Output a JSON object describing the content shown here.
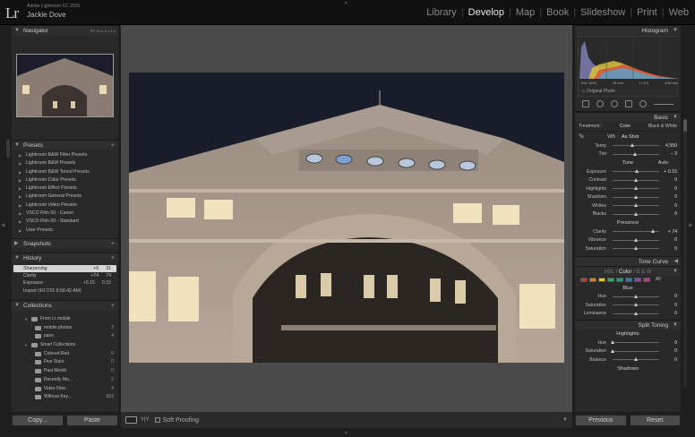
{
  "app": {
    "logo": "Lr",
    "version": "Adobe Lightroom CC 2015",
    "user": "Jackie Dove"
  },
  "modules": [
    "Library",
    "Develop",
    "Map",
    "Book",
    "Slideshow",
    "Print",
    "Web"
  ],
  "active_module": "Develop",
  "left": {
    "navigator": {
      "title": "Navigator",
      "zoom": "FIT  FILL  1:1  1:2"
    },
    "presets": {
      "title": "Presets",
      "items": [
        "Lightroom B&W Filter Presets",
        "Lightroom B&W Presets",
        "Lightroom B&W Toned Presets",
        "Lightroom Color Presets",
        "Lightroom Effect Presets",
        "Lightroom General Presets",
        "Lightroom Video Presets",
        "VSCO Film 00 - Canon",
        "VSCO Film 00 - Standard",
        "User Presets"
      ]
    },
    "snapshots": {
      "title": "Snapshots"
    },
    "history": {
      "title": "History",
      "items": [
        {
          "name": "Sharpening",
          "v1": "+6",
          "v2": "31",
          "selected": true
        },
        {
          "name": "Clarity",
          "v1": "+74",
          "v2": "74",
          "selected": false
        },
        {
          "name": "Exposure",
          "v1": "+0.15",
          "v2": "0.15",
          "selected": false
        },
        {
          "name": "Import (4/17/15 9:56:42 AM)",
          "v1": "",
          "v2": "",
          "selected": false
        }
      ]
    },
    "collections": {
      "title": "Collections",
      "items": [
        {
          "name": "From Lr mobile",
          "count": "",
          "indent": 1,
          "type": "set"
        },
        {
          "name": "mobile photos",
          "count": "2",
          "indent": 2,
          "type": "coll"
        },
        {
          "name": "pano",
          "count": "4",
          "indent": 2,
          "type": "coll"
        },
        {
          "name": "Smart Collections",
          "count": "",
          "indent": 1,
          "type": "set"
        },
        {
          "name": "Colored Red",
          "count": "0",
          "indent": 2,
          "type": "coll"
        },
        {
          "name": "Five Stars",
          "count": "0",
          "indent": 2,
          "type": "coll"
        },
        {
          "name": "Past Month",
          "count": "0",
          "indent": 2,
          "type": "coll"
        },
        {
          "name": "Recently Mo...",
          "count": "2",
          "indent": 2,
          "type": "coll"
        },
        {
          "name": "Video Files",
          "count": "4",
          "indent": 2,
          "type": "coll"
        },
        {
          "name": "Without Key...",
          "count": "603",
          "indent": 2,
          "type": "coll"
        }
      ]
    },
    "buttons": {
      "copy": "Copy...",
      "paste": "Paste"
    }
  },
  "toolbar": {
    "soft_proofing": "Soft Proofing",
    "view_label": "Y|Y"
  },
  "right": {
    "histogram": {
      "title": "Histogram",
      "iso": "ISO 1600",
      "focal": "25 mm",
      "aperture": "f / 4.0",
      "shutter": "1/30 sec",
      "original": "Original Photo"
    },
    "basic": {
      "title": "Basic",
      "treatment_label": "Treatment :",
      "color": "Color",
      "bw": "Black & White",
      "wb_label": "WB :",
      "wb_value": "As Shot",
      "temp": {
        "label": "Temp",
        "value": "4,550",
        "pos": 0.42
      },
      "tint": {
        "label": "Tint",
        "value": "− 3",
        "pos": 0.48
      },
      "tone": "Tone",
      "auto": "Auto",
      "tone_sliders": [
        {
          "label": "Exposure",
          "value": "+ 0.15",
          "pos": 0.52
        },
        {
          "label": "Contrast",
          "value": "0",
          "pos": 0.5
        },
        {
          "label": "Highlights",
          "value": "0",
          "pos": 0.5
        },
        {
          "label": "Shadows",
          "value": "0",
          "pos": 0.5
        },
        {
          "label": "Whites",
          "value": "0",
          "pos": 0.5
        },
        {
          "label": "Blacks",
          "value": "0",
          "pos": 0.5
        }
      ],
      "presence": "Presence",
      "presence_sliders": [
        {
          "label": "Clarity",
          "value": "+ 74",
          "pos": 0.87
        },
        {
          "label": "Vibrance",
          "value": "0",
          "pos": 0.5
        },
        {
          "label": "Saturation",
          "value": "0",
          "pos": 0.5
        }
      ]
    },
    "tone_curve": {
      "title": "Tone Curve"
    },
    "hsl": {
      "title": "HSL / Color / B & W",
      "hsl": "HSL",
      "color": "Color",
      "bw": "B & W",
      "all": "All",
      "section": "Blue",
      "sliders": [
        {
          "label": "Hue",
          "value": "0",
          "pos": 0.5
        },
        {
          "label": "Saturation",
          "value": "0",
          "pos": 0.5
        },
        {
          "label": "Luminance",
          "value": "0",
          "pos": 0.5
        }
      ]
    },
    "split": {
      "title": "Split Toning",
      "highlights": "Highlights",
      "balance": "Balance",
      "shadows": "Shadows",
      "sliders": [
        {
          "label": "Hue",
          "value": "0",
          "pos": 0.0
        },
        {
          "label": "Saturation",
          "value": "0",
          "pos": 0.0
        }
      ],
      "balance_val": {
        "label": "Balance",
        "value": "0",
        "pos": 0.5
      }
    },
    "buttons": {
      "previous": "Previous",
      "reset": "Reset"
    }
  },
  "colors": {
    "chips": [
      "#c0392b",
      "#e67e22",
      "#f1c40f",
      "#27ae60",
      "#16a085",
      "#2980b9",
      "#8e44ad",
      "#c0398b"
    ]
  }
}
